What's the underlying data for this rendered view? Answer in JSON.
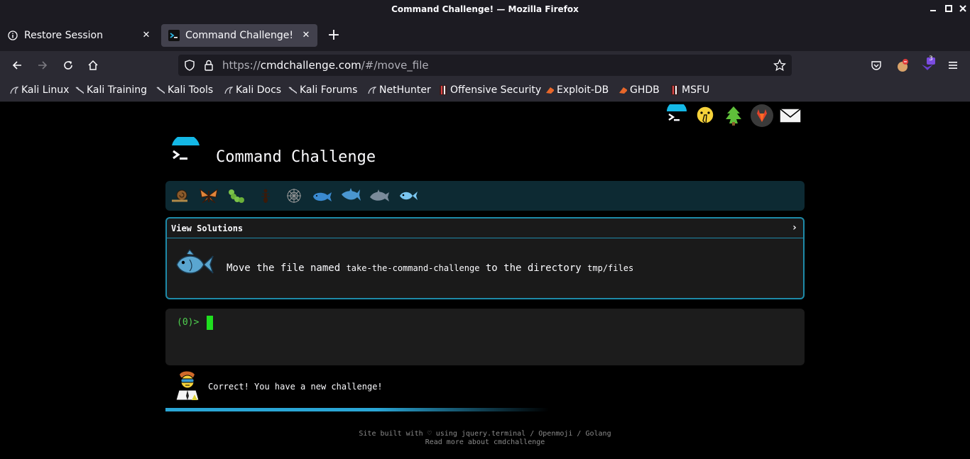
{
  "window": {
    "title": "Command Challenge! — Mozilla Firefox"
  },
  "tabs": [
    {
      "label": "Restore Session",
      "icon": "info-icon",
      "active": false
    },
    {
      "label": "Command Challenge!",
      "icon": "terminal-favicon-icon",
      "active": true
    }
  ],
  "urlbar": {
    "scheme": "https://",
    "host": "cmdchallenge.com",
    "path": "/#/move_file"
  },
  "toolbar": {
    "extension_badge": "3"
  },
  "bookmarks": [
    {
      "label": "Kali Linux",
      "icon": "kali-dragon-icon"
    },
    {
      "label": "Kali Training",
      "icon": "kali-dragon-icon"
    },
    {
      "label": "Kali Tools",
      "icon": "kali-dragon-icon"
    },
    {
      "label": "Kali Docs",
      "icon": "kali-dragon-icon"
    },
    {
      "label": "Kali Forums",
      "icon": "kali-dragon-icon"
    },
    {
      "label": "NetHunter",
      "icon": "kali-dragon-icon"
    },
    {
      "label": "Offensive Security",
      "icon": "offsec-icon"
    },
    {
      "label": "Exploit-DB",
      "icon": "exploit-db-icon"
    },
    {
      "label": "GHDB",
      "icon": "exploit-db-icon"
    },
    {
      "label": "MSFU",
      "icon": "offsec-icon"
    }
  ],
  "page": {
    "site_title": "Command Challenge",
    "top_icons": [
      "terminal-logo-icon",
      "shushing-face-icon",
      "tree-icon",
      "gitlab-icon",
      "envelope-icon"
    ],
    "levels": [
      "snail-icon",
      "butterfly-icon",
      "caterpillar-icon",
      "ant-icon",
      "spider-web-icon",
      "whale-icon",
      "shark-icon",
      "dolphin-icon",
      "fish-icon"
    ],
    "solutions_label": "View Solutions",
    "solutions_chevron": "›",
    "challenge": {
      "text_1": "Move the file named ",
      "code_1": "take-the-command-challenge",
      "text_2": " to the directory ",
      "code_2": "tmp/files"
    },
    "terminal": {
      "prompt": "(0)> "
    },
    "feedback": {
      "message": "Correct! You have a new challenge!"
    },
    "progress": 0.55,
    "footer": {
      "line1": "Site built with ♡ using jquery.terminal / Openmoji / Golang",
      "line2": "Read more about cmdchallenge"
    }
  },
  "colors": {
    "accent": "#1e8aa8",
    "prompt_green": "#4fd14f",
    "cursor_green": "#1fdf1f"
  }
}
